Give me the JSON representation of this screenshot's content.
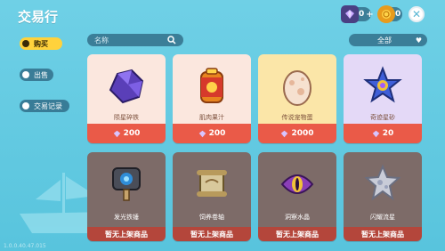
{
  "header": {
    "title": "交易行",
    "gem_balance": "0",
    "gem_plus": "+",
    "coin_balance": "0"
  },
  "sidebar": {
    "items": [
      {
        "label": "购买",
        "active": true
      },
      {
        "label": "出售",
        "active": false
      },
      {
        "label": "交易记录",
        "active": false
      }
    ]
  },
  "search": {
    "placeholder": "名称"
  },
  "filter": {
    "selected": "全部"
  },
  "shop": {
    "items": [
      {
        "name": "陨星碎铁",
        "price": "200",
        "bg": "#fbe7de"
      },
      {
        "name": "肌肉果汁",
        "price": "200",
        "bg": "#fbe7de"
      },
      {
        "name": "传说宠物蛋",
        "price": "2000",
        "bg": "#fbe6a8"
      },
      {
        "name": "奇迹星砂",
        "price": "20",
        "bg": "#e4d9f7"
      }
    ],
    "locked_items": [
      {
        "name": "发光铁锤",
        "status": "暂无上架商品"
      },
      {
        "name": "饲养卷轴",
        "status": "暂无上架商品"
      },
      {
        "name": "洞察水晶",
        "status": "暂无上架商品"
      },
      {
        "name": "闪耀流星",
        "status": "暂无上架商品"
      }
    ]
  },
  "footer": {
    "version": "1.0.0.40.47.015"
  },
  "colors": {
    "background": "#5ec8e0",
    "price_bar": "#ea5a48",
    "active_tab": "#ffd23c",
    "locked_card": "#7d6b68"
  }
}
